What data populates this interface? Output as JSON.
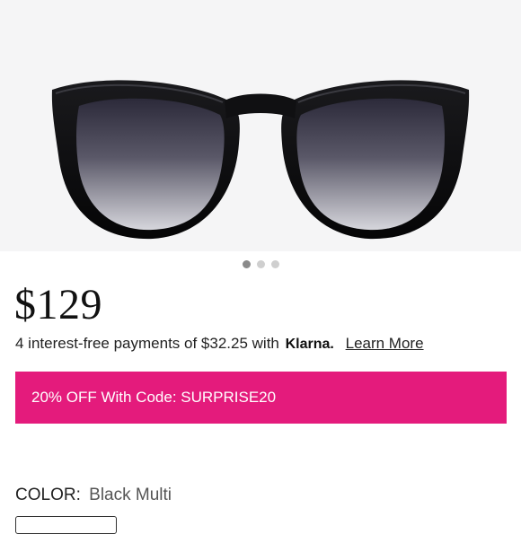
{
  "product": {
    "image_icon": "sunglasses-image",
    "carousel": {
      "count": 3,
      "active": 1
    },
    "price": "$129",
    "payment": {
      "text": "4 interest-free payments of $32.25 with",
      "provider": "Klarna.",
      "learn_more": "Learn More"
    },
    "promo": {
      "text": "20% OFF With Code: SURPRISE20",
      "color": "#e41b7c"
    },
    "color": {
      "label": "COLOR:",
      "value": "Black Multi"
    }
  }
}
